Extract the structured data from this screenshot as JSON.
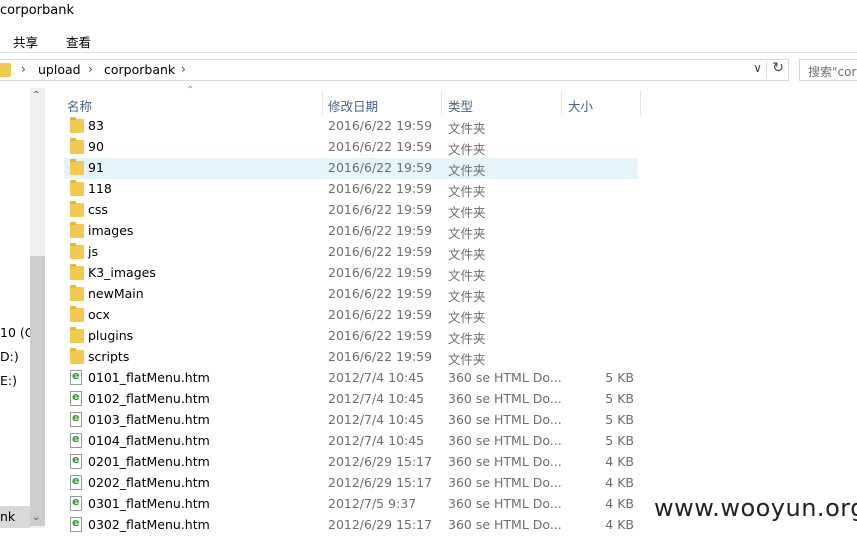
{
  "window": {
    "title": "corporbank"
  },
  "ribbon": {
    "tabs": [
      "共享",
      "查看"
    ]
  },
  "address": {
    "crumbs": [
      "upload",
      "corporbank"
    ],
    "separator": "›",
    "dropdown": "∨",
    "refresh": "↻"
  },
  "search": {
    "placeholder": "搜索\"cor"
  },
  "nav": {
    "drives": [
      "10 (C:",
      "D:)",
      "E:)",
      "nk"
    ]
  },
  "columns": {
    "name": "名称",
    "date": "修改日期",
    "type": "类型",
    "size": "大小"
  },
  "files": [
    {
      "name": "83",
      "date": "2016/6/22 19:59",
      "type": "文件夹",
      "size": "",
      "kind": "folder"
    },
    {
      "name": "90",
      "date": "2016/6/22 19:59",
      "type": "文件夹",
      "size": "",
      "kind": "folder"
    },
    {
      "name": "91",
      "date": "2016/6/22 19:59",
      "type": "文件夹",
      "size": "",
      "kind": "folder",
      "highlighted": true
    },
    {
      "name": "118",
      "date": "2016/6/22 19:59",
      "type": "文件夹",
      "size": "",
      "kind": "folder"
    },
    {
      "name": "css",
      "date": "2016/6/22 19:59",
      "type": "文件夹",
      "size": "",
      "kind": "folder"
    },
    {
      "name": "images",
      "date": "2016/6/22 19:59",
      "type": "文件夹",
      "size": "",
      "kind": "folder"
    },
    {
      "name": "js",
      "date": "2016/6/22 19:59",
      "type": "文件夹",
      "size": "",
      "kind": "folder"
    },
    {
      "name": "K3_images",
      "date": "2016/6/22 19:59",
      "type": "文件夹",
      "size": "",
      "kind": "folder"
    },
    {
      "name": "newMain",
      "date": "2016/6/22 19:59",
      "type": "文件夹",
      "size": "",
      "kind": "folder"
    },
    {
      "name": "ocx",
      "date": "2016/6/22 19:59",
      "type": "文件夹",
      "size": "",
      "kind": "folder"
    },
    {
      "name": "plugins",
      "date": "2016/6/22 19:59",
      "type": "文件夹",
      "size": "",
      "kind": "folder"
    },
    {
      "name": "scripts",
      "date": "2016/6/22 19:59",
      "type": "文件夹",
      "size": "",
      "kind": "folder"
    },
    {
      "name": "0101_flatMenu.htm",
      "date": "2012/7/4 10:45",
      "type": "360 se HTML Do...",
      "size": "5 KB",
      "kind": "html"
    },
    {
      "name": "0102_flatMenu.htm",
      "date": "2012/7/4 10:45",
      "type": "360 se HTML Do...",
      "size": "5 KB",
      "kind": "html"
    },
    {
      "name": "0103_flatMenu.htm",
      "date": "2012/7/4 10:45",
      "type": "360 se HTML Do...",
      "size": "5 KB",
      "kind": "html"
    },
    {
      "name": "0104_flatMenu.htm",
      "date": "2012/7/4 10:45",
      "type": "360 se HTML Do...",
      "size": "5 KB",
      "kind": "html"
    },
    {
      "name": "0201_flatMenu.htm",
      "date": "2012/6/29 15:17",
      "type": "360 se HTML Do...",
      "size": "4 KB",
      "kind": "html"
    },
    {
      "name": "0202_flatMenu.htm",
      "date": "2012/6/29 15:17",
      "type": "360 se HTML Do...",
      "size": "4 KB",
      "kind": "html"
    },
    {
      "name": "0301_flatMenu.htm",
      "date": "2012/7/5 9:37",
      "type": "360 se HTML Do...",
      "size": "4 KB",
      "kind": "html"
    },
    {
      "name": "0302_flatMenu.htm",
      "date": "2012/6/29 15:17",
      "type": "360 se HTML Do...",
      "size": "4 KB",
      "kind": "html"
    }
  ],
  "watermark": "www.wooyun.org",
  "colors": {
    "folder": "#f4c94f",
    "highlight": "#e5f3fb",
    "header_text": "#4d6185"
  }
}
